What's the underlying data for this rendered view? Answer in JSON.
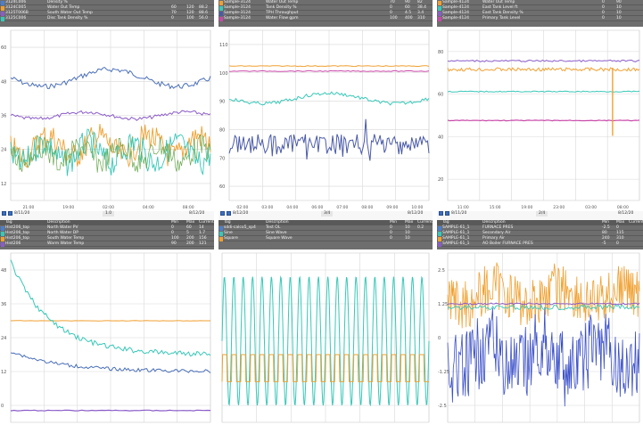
{
  "legend_header": {
    "tag": "Tag",
    "description": "Description",
    "min": "Min",
    "max": "Max",
    "current": "Current"
  },
  "panels": [
    {
      "legend": [
        {
          "tag": "3124C006",
          "desc": "Density %",
          "min": "",
          "max": "",
          "cur": "",
          "color": "#4a7fd0"
        },
        {
          "tag": "3124C005",
          "desc": "Water Out Temp",
          "min": "60",
          "max": "120",
          "cur": "88.2",
          "color": "#f0a030"
        },
        {
          "tag": "3125T006B",
          "desc": "South Water Out Temp",
          "min": "70",
          "max": "120",
          "cur": "88.6",
          "color": "#8a5cc8"
        },
        {
          "tag": "3125C006",
          "desc": "Disc Tank Density %",
          "min": "0",
          "max": "100",
          "cur": "56.0",
          "color": "#38c8b8"
        }
      ],
      "y_ticks": [
        "60",
        "48",
        "36",
        "24",
        "12"
      ],
      "x_ticks": [
        "21:00",
        "19:00",
        "02:00",
        "04:00",
        "08:00"
      ],
      "date_left": "8/11/20",
      "date_right": "8/12/20",
      "zoom": "1.0"
    },
    {
      "legend": [
        {
          "tag": "Sample-3124",
          "desc": "Water Out Temp",
          "min": "70",
          "max": "90",
          "cur": "82",
          "color": "#f0a030"
        },
        {
          "tag": "Sample-3124",
          "desc": "Tank Density %",
          "min": "0",
          "max": "60",
          "cur": "38.4",
          "color": "#38c8b8"
        },
        {
          "tag": "Sample-3124",
          "desc": "TPH Throughput",
          "min": "0",
          "max": "4.5",
          "cur": "3.4",
          "color": "#4a5aa8"
        },
        {
          "tag": "Sample-3124",
          "desc": "Water Flow gpm",
          "min": "100",
          "max": "400",
          "cur": "310",
          "color": "#c848a8"
        }
      ],
      "y_ticks": [
        "110",
        "100",
        "90",
        "80",
        "70",
        "60"
      ],
      "x_ticks": [
        "02:00",
        "03:00",
        "04:00",
        "06:00",
        "07:00",
        "08:00",
        "09:00",
        "10:00"
      ],
      "date_left": "8/12/20",
      "date_right": "8/12/20",
      "zoom": "3/4"
    },
    {
      "legend": [
        {
          "tag": "Sample-4124",
          "desc": "Water Out Temp",
          "min": "0",
          "max": "90",
          "cur": "",
          "color": "#f0a030"
        },
        {
          "tag": "Sample-4124",
          "desc": "East Tank Level ft",
          "min": "0",
          "max": "10",
          "cur": "",
          "color": "#38c8b8"
        },
        {
          "tag": "Sample-4124",
          "desc": "East Tank Density %",
          "min": "0",
          "max": "10",
          "cur": "",
          "color": "#8a5cc8"
        },
        {
          "tag": "Sample-4124",
          "desc": "Primary Tank Level",
          "min": "0",
          "max": "10",
          "cur": "",
          "color": "#c848a8"
        }
      ],
      "y_ticks": [
        "80",
        "60",
        "40",
        "20"
      ],
      "x_ticks": [
        "11:00",
        "15:00",
        "19:00",
        "23:00",
        "03:00",
        "08:00"
      ],
      "date_left": "8/11/20",
      "date_right": "8/12/20",
      "zoom": "2/4"
    },
    {
      "legend": [
        {
          "tag": "Hist206_top",
          "desc": "North Water PV",
          "min": "0",
          "max": "60",
          "cur": "14",
          "color": "#4a7fd0"
        },
        {
          "tag": "Hist206_top",
          "desc": "North Water DP",
          "min": "0",
          "max": "5",
          "cur": "1.7",
          "color": "#38c8b8"
        },
        {
          "tag": "Hist206_top",
          "desc": "South Water Temp",
          "min": "100",
          "max": "200",
          "cur": "156",
          "color": "#f0a030"
        },
        {
          "tag": "Hist206",
          "desc": "Warm Water Temp",
          "min": "90",
          "max": "200",
          "cur": "121",
          "color": "#8a5cc8"
        }
      ],
      "y_ticks": [
        "48",
        "36",
        "24",
        "12",
        "0"
      ],
      "x_ticks": [],
      "date_left": "",
      "date_right": "",
      "zoom": ""
    },
    {
      "legend": [
        {
          "tag": "sddi-calco5_sp4",
          "desc": "Test OL",
          "min": "0",
          "max": "10",
          "cur": "0.2",
          "color": "#4a7fd0"
        },
        {
          "tag": "Sine",
          "desc": "Sine Wave",
          "min": "0",
          "max": "10",
          "cur": "",
          "color": "#38c8b8"
        },
        {
          "tag": "Square",
          "desc": "Square Wave",
          "min": "0",
          "max": "10",
          "cur": "",
          "color": "#f0a030"
        }
      ],
      "y_ticks": [],
      "x_ticks": [],
      "date_left": "",
      "date_right": "",
      "zoom": ""
    },
    {
      "legend": [
        {
          "tag": "SAMPLE-61_1",
          "desc": "FURNACE PRES",
          "min": "-2.5",
          "max": "0",
          "cur": "",
          "color": "#4a7fd0"
        },
        {
          "tag": "SAMPLE-61_1",
          "desc": "Secondary Air",
          "min": "80",
          "max": "115",
          "cur": "",
          "color": "#38c8b8"
        },
        {
          "tag": "SAMPLE-61_1",
          "desc": "Primary Air",
          "min": "240",
          "max": "310",
          "cur": "",
          "color": "#f0a030"
        },
        {
          "tag": "SAMPLE-61_1",
          "desc": "AO Boiler FURNACE PRES",
          "min": "-5",
          "max": "0",
          "cur": "",
          "color": "#8a5cc8"
        }
      ],
      "y_ticks": [
        "2.5",
        "1.25",
        "0",
        "-1.25",
        "-2.5"
      ],
      "x_ticks": [],
      "date_left": "",
      "date_right": "",
      "zoom": ""
    }
  ]
}
